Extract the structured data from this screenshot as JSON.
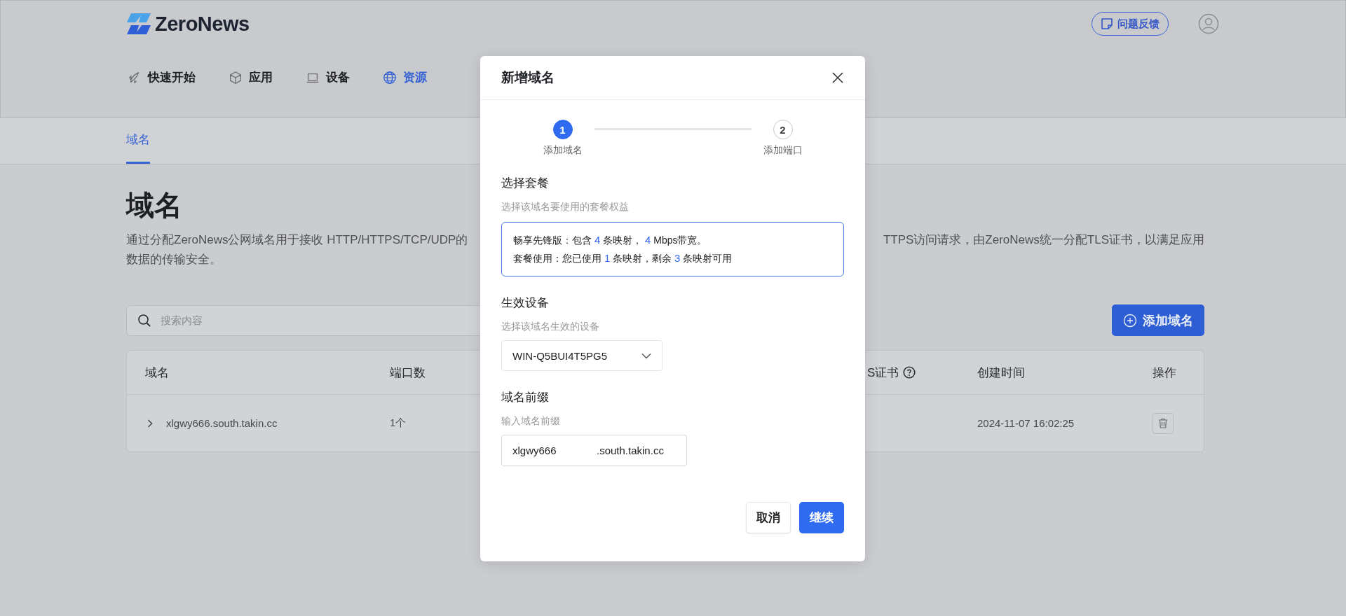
{
  "header": {
    "logo": "ZeroNews",
    "feedback_button": "问题反馈",
    "nav": [
      {
        "label": "快速开始",
        "selected": false
      },
      {
        "label": "应用",
        "selected": false
      },
      {
        "label": "设备",
        "selected": false
      },
      {
        "label": "资源",
        "selected": true
      }
    ]
  },
  "tabs": [
    {
      "label": "域名",
      "selected": true
    }
  ],
  "page": {
    "title": "域名",
    "description": {
      "line_1_left": "通过分配ZeroNews公网域名用于接收 HTTP/HTTPS/TCP/UDP的",
      "line_1_right": "TTPS访问请求，由ZeroNews统一分配TLS证书，以满足应用",
      "line_2": "数据的传输安全。"
    }
  },
  "search": {
    "placeholder": "搜索内容"
  },
  "add_button": "添加域名",
  "table": {
    "columns": [
      "域名",
      "端口数",
      "S证书",
      "创建时间",
      "操作"
    ],
    "rows": [
      {
        "expanded": false,
        "domain": "xlgwy666.south.takin.cc",
        "ports": "1个",
        "created": "2024-11-07 16:02:25"
      }
    ]
  },
  "modal": {
    "title": "新增域名",
    "steps": [
      {
        "number": "1",
        "label": "添加域名",
        "current": true
      },
      {
        "number": "2",
        "label": "添加端口",
        "current": false
      }
    ],
    "plan": {
      "label": "选择套餐",
      "hint": "选择该域名要使用的套餐权益",
      "lines": [
        [
          {
            "text": "畅享先锋版：包含 ",
            "highlight": false
          },
          {
            "text": "4",
            "highlight": true
          },
          {
            "text": " 条映射， ",
            "highlight": false
          },
          {
            "text": "4",
            "highlight": true
          },
          {
            "text": " Mbps带宽。",
            "highlight": false
          }
        ],
        [
          {
            "text": "套餐使用：您已使用 ",
            "highlight": false
          },
          {
            "text": "1",
            "highlight": true
          },
          {
            "text": " 条映射，剩余 ",
            "highlight": false
          },
          {
            "text": "3",
            "highlight": true
          },
          {
            "text": " 条映射可用",
            "highlight": false
          }
        ]
      ]
    },
    "device": {
      "label": "生效设备",
      "hint": "选择该域名生效的设备",
      "value": "WIN-Q5BUI4T5PG5"
    },
    "prefix": {
      "label": "域名前缀",
      "hint": "输入域名前缀",
      "value": "xlgwy666",
      "suffix": ".south.takin.cc"
    },
    "buttons": [
      {
        "label": "取消",
        "kind": "secondary"
      },
      {
        "label": "继续",
        "kind": "primary"
      }
    ]
  }
}
